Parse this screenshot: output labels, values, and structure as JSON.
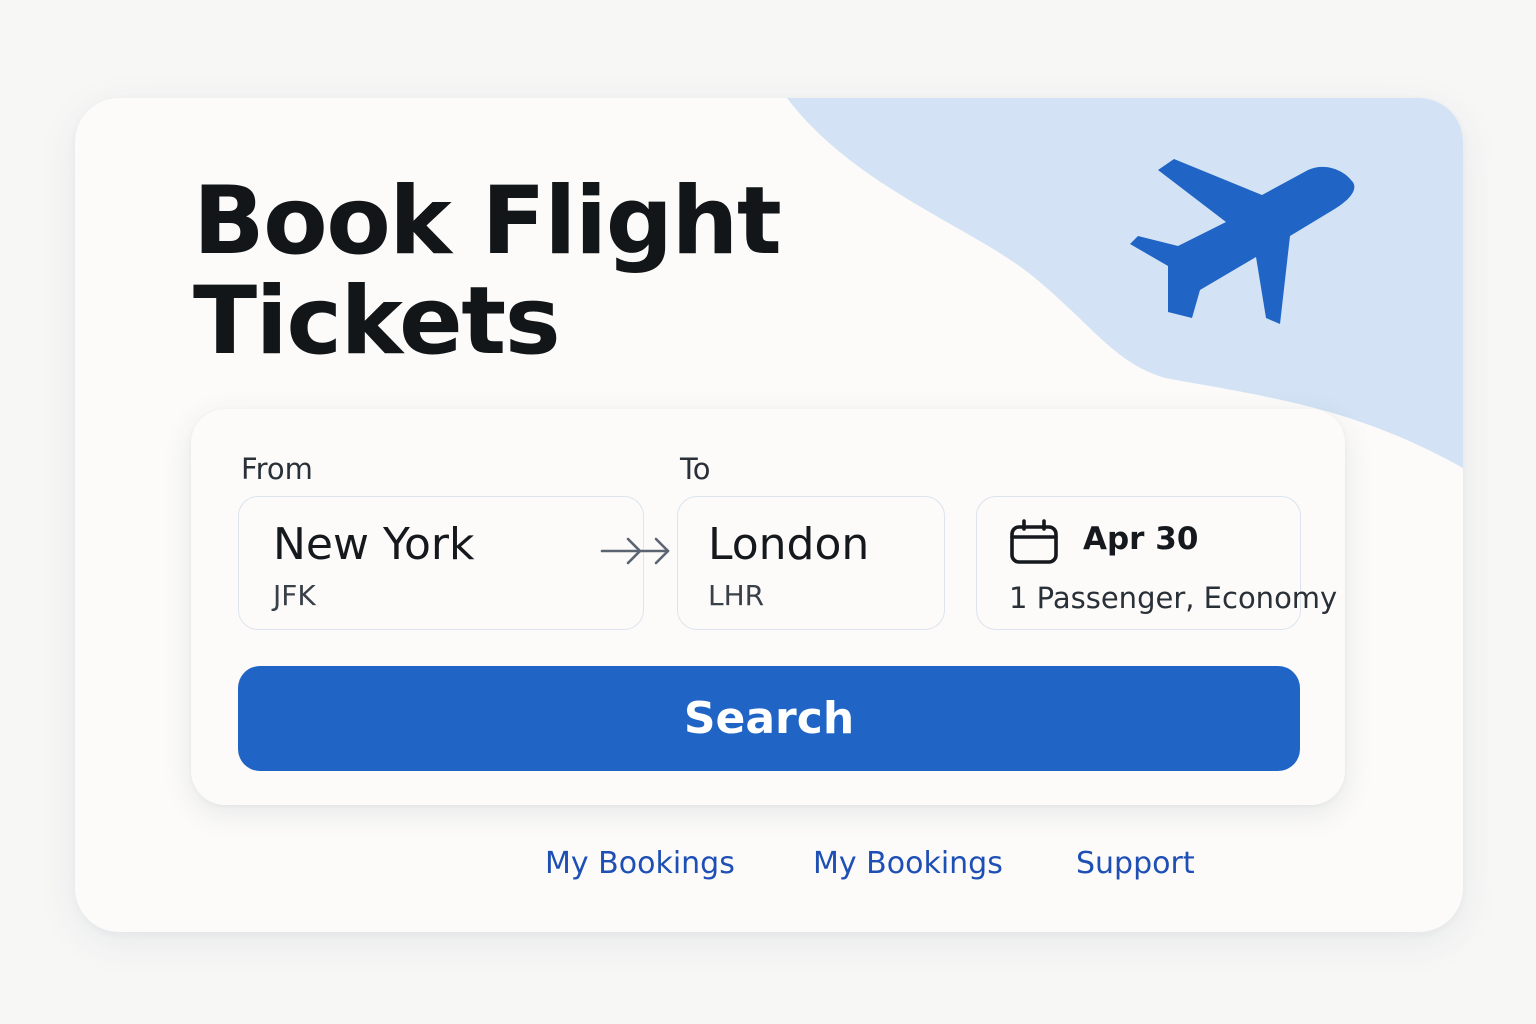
{
  "hero": {
    "title_line1": "Book Flight",
    "title_line2": "Tickets"
  },
  "form": {
    "from": {
      "label": "From",
      "city": "New York",
      "code": "JFK"
    },
    "to": {
      "label": "To",
      "city": "London",
      "code": "LHR"
    },
    "date": "Apr 30",
    "passengers": "1 Passenger, Economy",
    "search_label": "Search"
  },
  "footer_links": [
    {
      "label": "My Bookings"
    },
    {
      "label": "My Bookings"
    },
    {
      "label": "Support"
    }
  ],
  "icons": {
    "plane": "airplane-icon",
    "arrow": "arrow-right-icon",
    "calendar": "calendar-icon"
  },
  "colors": {
    "accent": "#2065c6",
    "wave": "#d3e3f5",
    "link": "#1d4fb5",
    "title": "#121619"
  }
}
